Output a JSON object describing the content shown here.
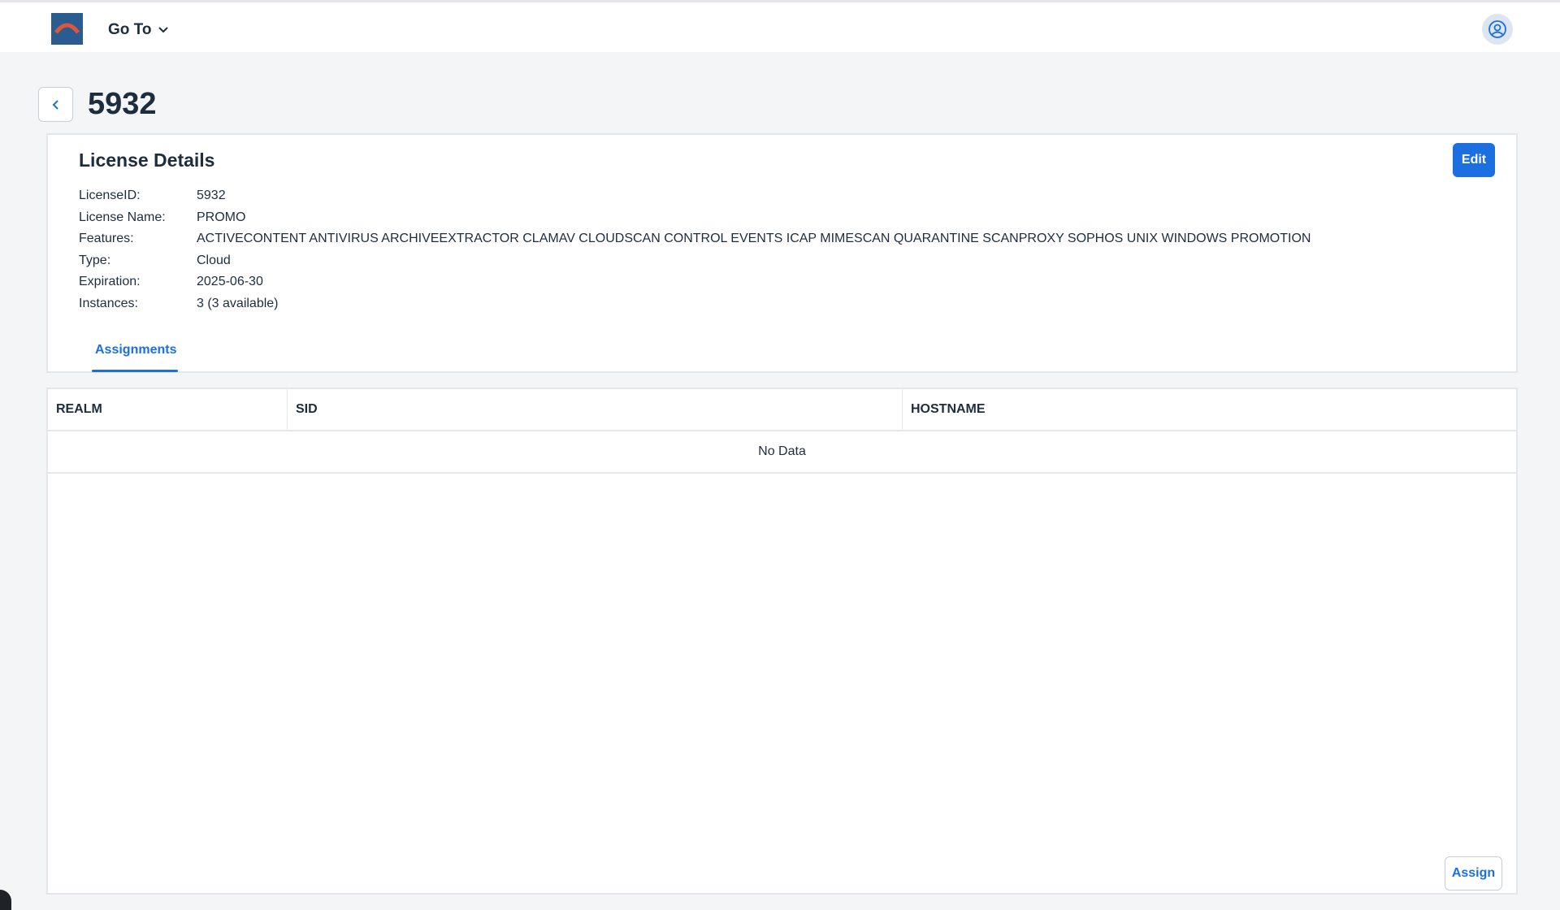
{
  "header": {
    "goto_label": "Go To"
  },
  "page": {
    "title": "5932"
  },
  "license_details": {
    "title": "License Details",
    "edit_label": "Edit",
    "fields": [
      {
        "label": "LicenseID:",
        "value": "5932"
      },
      {
        "label": "License Name:",
        "value": "PROMO"
      },
      {
        "label": "Features:",
        "value": "ACTIVECONTENT ANTIVIRUS ARCHIVEEXTRACTOR CLAMAV CLOUDSCAN CONTROL EVENTS ICAP MIMESCAN QUARANTINE SCANPROXY SOPHOS UNIX WINDOWS PROMOTION"
      },
      {
        "label": "Type:",
        "value": "Cloud"
      },
      {
        "label": "Expiration:",
        "value": "2025-06-30"
      },
      {
        "label": "Instances:",
        "value": "3 (3 available)"
      }
    ],
    "tabs": [
      {
        "label": "Assignments"
      }
    ]
  },
  "assignments_table": {
    "columns": [
      "REALM",
      "SID",
      "HOSTNAME"
    ],
    "empty_text": "No Data",
    "assign_label": "Assign"
  },
  "colors": {
    "accent": "#1b6fe0",
    "logo_bg": "#2b5c8f",
    "logo_arc": "#e0533d"
  }
}
